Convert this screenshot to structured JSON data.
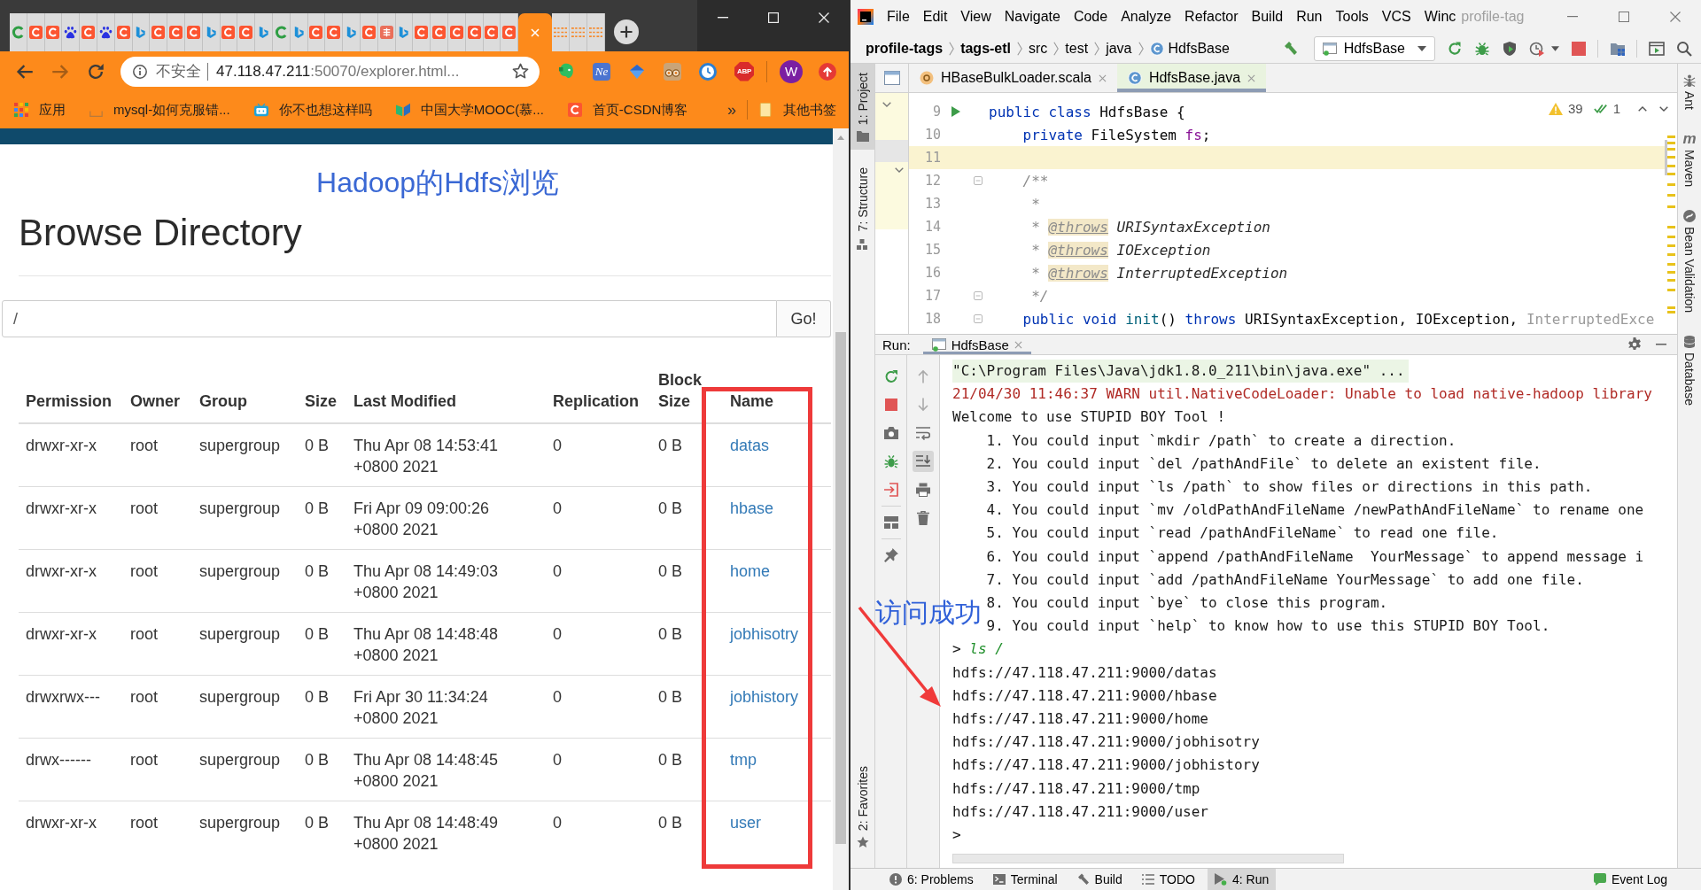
{
  "browser": {
    "tabs": [
      {
        "kind": "c_green",
        "selected": false
      },
      {
        "kind": "csdn",
        "selected": false
      },
      {
        "kind": "csdn",
        "selected": false
      },
      {
        "kind": "baidu",
        "selected": false
      },
      {
        "kind": "csdn",
        "selected": false
      },
      {
        "kind": "baidu",
        "selected": false
      },
      {
        "kind": "csdn",
        "selected": false
      },
      {
        "kind": "bing",
        "selected": false
      },
      {
        "kind": "csdn",
        "selected": false
      },
      {
        "kind": "csdn",
        "selected": false
      },
      {
        "kind": "csdn",
        "selected": false
      },
      {
        "kind": "bing",
        "selected": false
      },
      {
        "kind": "csdn",
        "selected": false
      },
      {
        "kind": "csdn",
        "selected": false
      },
      {
        "kind": "bing",
        "selected": false
      },
      {
        "kind": "c_green",
        "selected": false
      },
      {
        "kind": "bing",
        "selected": false
      },
      {
        "kind": "csdn",
        "selected": false
      },
      {
        "kind": "csdn",
        "selected": false
      },
      {
        "kind": "bing",
        "selected": false
      },
      {
        "kind": "csdn",
        "selected": false
      },
      {
        "kind": "jian",
        "selected": false
      },
      {
        "kind": "bing",
        "selected": false
      },
      {
        "kind": "csdn",
        "selected": false
      },
      {
        "kind": "csdn",
        "selected": false
      },
      {
        "kind": "csdn",
        "selected": false
      },
      {
        "kind": "csdn",
        "selected": false
      },
      {
        "kind": "csdn",
        "selected": false
      },
      {
        "kind": "csdn",
        "selected": false
      },
      {
        "selected": true
      },
      {
        "kind": "stack",
        "selected": false
      },
      {
        "kind": "stack",
        "selected": false
      },
      {
        "kind": "stack",
        "selected": false
      }
    ],
    "address": {
      "security": "不安全",
      "host": "47.118.47.211",
      "path": ":50070/explorer.html..."
    },
    "extensions": [
      {
        "kind": "elephant"
      },
      {
        "kind": "ne",
        "label": "Ne"
      },
      {
        "kind": "diamond"
      },
      {
        "kind": "eyes"
      },
      {
        "kind": "clock"
      },
      {
        "kind": "abp",
        "label": "ABP"
      }
    ],
    "profile": {
      "initial": "W"
    },
    "bookmarks": [
      {
        "kind": "apps",
        "label": "应用"
      },
      {
        "kind": "page",
        "label": "mysql-如何克服错..."
      },
      {
        "kind": "tv",
        "label": "你不也想这样吗"
      },
      {
        "kind": "book",
        "label": "中国大学MOOC(慕..."
      },
      {
        "kind": "csdn",
        "label": "首页-CSDN博客"
      }
    ],
    "overflow": "»",
    "other_bookmarks": "其他书签"
  },
  "hdfs_page": {
    "site_title": "Hadoop的Hdfs浏览",
    "heading": "Browse Directory",
    "path_value": "/",
    "go_button": "Go!",
    "columns": [
      "Permission",
      "Owner",
      "Group",
      "Size",
      "Last Modified",
      "Replication",
      "Block Size",
      "Name"
    ],
    "rows": [
      {
        "permission": "drwxr-xr-x",
        "owner": "root",
        "group": "supergroup",
        "size": "0 B",
        "last_modified": "Thu Apr 08 14:53:41 +0800 2021",
        "replication": "0",
        "block_size": "0 B",
        "name": "datas"
      },
      {
        "permission": "drwxr-xr-x",
        "owner": "root",
        "group": "supergroup",
        "size": "0 B",
        "last_modified": "Fri Apr 09 09:00:26 +0800 2021",
        "replication": "0",
        "block_size": "0 B",
        "name": "hbase"
      },
      {
        "permission": "drwxr-xr-x",
        "owner": "root",
        "group": "supergroup",
        "size": "0 B",
        "last_modified": "Thu Apr 08 14:49:03 +0800 2021",
        "replication": "0",
        "block_size": "0 B",
        "name": "home"
      },
      {
        "permission": "drwxr-xr-x",
        "owner": "root",
        "group": "supergroup",
        "size": "0 B",
        "last_modified": "Thu Apr 08 14:48:48 +0800 2021",
        "replication": "0",
        "block_size": "0 B",
        "name": "jobhisotry"
      },
      {
        "permission": "drwxrwx---",
        "owner": "root",
        "group": "supergroup",
        "size": "0 B",
        "last_modified": "Fri Apr 30 11:34:24 +0800 2021",
        "replication": "0",
        "block_size": "0 B",
        "name": "jobhistory"
      },
      {
        "permission": "drwx------",
        "owner": "root",
        "group": "supergroup",
        "size": "0 B",
        "last_modified": "Thu Apr 08 14:48:45 +0800 2021",
        "replication": "0",
        "block_size": "0 B",
        "name": "tmp"
      },
      {
        "permission": "drwxr-xr-x",
        "owner": "root",
        "group": "supergroup",
        "size": "0 B",
        "last_modified": "Thu Apr 08 14:48:49 +0800 2021",
        "replication": "0",
        "block_size": "0 B",
        "name": "user"
      }
    ]
  },
  "ide": {
    "menu": [
      "File",
      "Edit",
      "View",
      "Navigate",
      "Code",
      "Analyze",
      "Refactor",
      "Build",
      "Run",
      "Tools",
      "VCS",
      "Winc"
    ],
    "window_title": "profile-tag",
    "breadcrumbs": [
      {
        "label": "profile-tags",
        "kind": "module"
      },
      {
        "label": "tags-etl",
        "kind": "module"
      },
      {
        "label": "src",
        "kind": "folder"
      },
      {
        "label": "test",
        "kind": "folder"
      },
      {
        "label": "java",
        "kind": "folder"
      },
      {
        "label": "HdfsBase",
        "kind": "class"
      }
    ],
    "run_config": "HdfsBase",
    "left_tools": [
      {
        "label": "1: Project",
        "kind": "project",
        "selected": true
      },
      {
        "label": "7: Structure",
        "kind": "structure",
        "selected": false
      }
    ],
    "left_bottom_tools": [
      {
        "label": "2: Favorites",
        "kind": "favorites",
        "selected": false
      }
    ],
    "right_tools": [
      {
        "label": "Ant",
        "kind": "ant"
      },
      {
        "label": "Maven",
        "kind": "maven",
        "glyph": "m"
      },
      {
        "label": "Bean Validation",
        "kind": "bean"
      },
      {
        "label": "Database",
        "kind": "database"
      }
    ],
    "editor_tabs": [
      {
        "label": "HBaseBulkLoader.scala",
        "kind": "scala",
        "selected": false
      },
      {
        "label": "HdfsBase.java",
        "kind": "java_class",
        "selected": true
      }
    ],
    "inspections": {
      "warnings": "39",
      "passed": "1"
    },
    "code_lines": [
      {
        "number": "9",
        "current": false,
        "run_marker": true,
        "fold": false,
        "tokens": [
          {
            "kind": "keyword",
            "text": "public class"
          },
          {
            "kind": "plain",
            "text": " HdfsBase {"
          }
        ]
      },
      {
        "number": "10",
        "current": false,
        "run_marker": false,
        "fold": false,
        "tokens": [
          {
            "kind": "keyword",
            "text": "    private"
          },
          {
            "kind": "plain",
            "text": " FileSystem "
          },
          {
            "kind": "field",
            "text": "fs"
          },
          {
            "kind": "plain",
            "text": ";"
          }
        ]
      },
      {
        "number": "11",
        "current": true,
        "run_marker": false,
        "fold": false
      },
      {
        "number": "12",
        "current": false,
        "run_marker": false,
        "fold": true,
        "tokens": [
          {
            "kind": "comment",
            "text": "    /**"
          }
        ]
      },
      {
        "number": "13",
        "current": false,
        "run_marker": false,
        "fold": false,
        "tokens": [
          {
            "kind": "comment",
            "text": "     *"
          }
        ]
      },
      {
        "number": "14",
        "current": false,
        "run_marker": false,
        "fold": false,
        "tokens": [
          {
            "kind": "comment",
            "text": "     * "
          },
          {
            "kind": "doc_tag",
            "text": "@throws"
          },
          {
            "kind": "doc_ref",
            "text": " URISyntaxException"
          }
        ]
      },
      {
        "number": "15",
        "current": false,
        "run_marker": false,
        "fold": false,
        "tokens": [
          {
            "kind": "comment",
            "text": "     * "
          },
          {
            "kind": "doc_tag",
            "text": "@throws"
          },
          {
            "kind": "doc_ref",
            "text": " IOException"
          }
        ]
      },
      {
        "number": "16",
        "current": false,
        "run_marker": false,
        "fold": false,
        "tokens": [
          {
            "kind": "comment",
            "text": "     * "
          },
          {
            "kind": "doc_tag",
            "text": "@throws"
          },
          {
            "kind": "doc_ref",
            "text": " InterruptedException"
          }
        ]
      },
      {
        "number": "17",
        "current": false,
        "run_marker": false,
        "fold": true,
        "tokens": [
          {
            "kind": "comment",
            "text": "     */"
          }
        ]
      },
      {
        "number": "18",
        "current": false,
        "run_marker": false,
        "fold": true,
        "tokens": [
          {
            "kind": "keyword",
            "text": "    public void "
          },
          {
            "kind": "method",
            "text": "init"
          },
          {
            "kind": "plain",
            "text": "() "
          },
          {
            "kind": "keyword",
            "text": "throws"
          },
          {
            "kind": "plain",
            "text": " URISyntaxException, IOException, "
          },
          {
            "kind": "unused",
            "text": "InterruptedExce"
          }
        ]
      }
    ],
    "run_panel": {
      "label": "Run:",
      "tab": "HdfsBase",
      "console": [
        {
          "kind": "command",
          "text": "\"C:\\Program Files\\Java\\jdk1.8.0_211\\bin\\java.exe\" ..."
        },
        {
          "kind": "warn",
          "text": "21/04/30 11:46:37 WARN util.NativeCodeLoader: Unable to load native-hadoop library"
        },
        {
          "kind": "output",
          "text": "Welcome to use STUPID BOY Tool !"
        },
        {
          "kind": "item",
          "text": "1. You could input `mkdir /path` to create a direction."
        },
        {
          "kind": "item",
          "text": "2. You could input `del /pathAndFile` to delete an existent file."
        },
        {
          "kind": "item",
          "text": "3. You could input `ls /path` to show files or directions in this path."
        },
        {
          "kind": "item",
          "text": "4. You could input `mv /oldPathAndFileName /newPathAndFileName` to rename one"
        },
        {
          "kind": "item",
          "text": "5. You could input `read /pathAndFileName` to read one file."
        },
        {
          "kind": "item",
          "text": "6. You could input `append /pathAndFileName  YourMessage` to append message i"
        },
        {
          "kind": "item",
          "text": "7. You could input `add /pathAndFileName YourMessage` to add one file."
        },
        {
          "kind": "item",
          "text": "8. You could input `bye` to close this program."
        },
        {
          "kind": "item",
          "text": "9. You could input `help` to know how to use this STUPID BOY Tool."
        },
        {
          "kind": "input",
          "prompt": ">",
          "text": "ls /"
        },
        {
          "kind": "output",
          "text": "hdfs://47.118.47.211:9000/datas"
        },
        {
          "kind": "output",
          "text": "hdfs://47.118.47.211:9000/hbase"
        },
        {
          "kind": "output",
          "text": "hdfs://47.118.47.211:9000/home"
        },
        {
          "kind": "output",
          "text": "hdfs://47.118.47.211:9000/jobhisotry"
        },
        {
          "kind": "output",
          "text": "hdfs://47.118.47.211:9000/jobhistory"
        },
        {
          "kind": "output",
          "text": "hdfs://47.118.47.211:9000/tmp"
        },
        {
          "kind": "output",
          "text": "hdfs://47.118.47.211:9000/user"
        },
        {
          "kind": "output",
          "text": ">"
        }
      ]
    },
    "bottom_tools": [
      {
        "label": "6: Problems",
        "kind": "problems",
        "selected": false
      },
      {
        "label": "Terminal",
        "kind": "terminal",
        "selected": false
      },
      {
        "label": "Build",
        "kind": "build",
        "selected": false
      },
      {
        "label": "TODO",
        "kind": "todo",
        "selected": false
      },
      {
        "label": "4: Run",
        "kind": "run",
        "selected": true
      }
    ],
    "event_log": "Event Log"
  },
  "annotation": {
    "text": "访问成功"
  }
}
